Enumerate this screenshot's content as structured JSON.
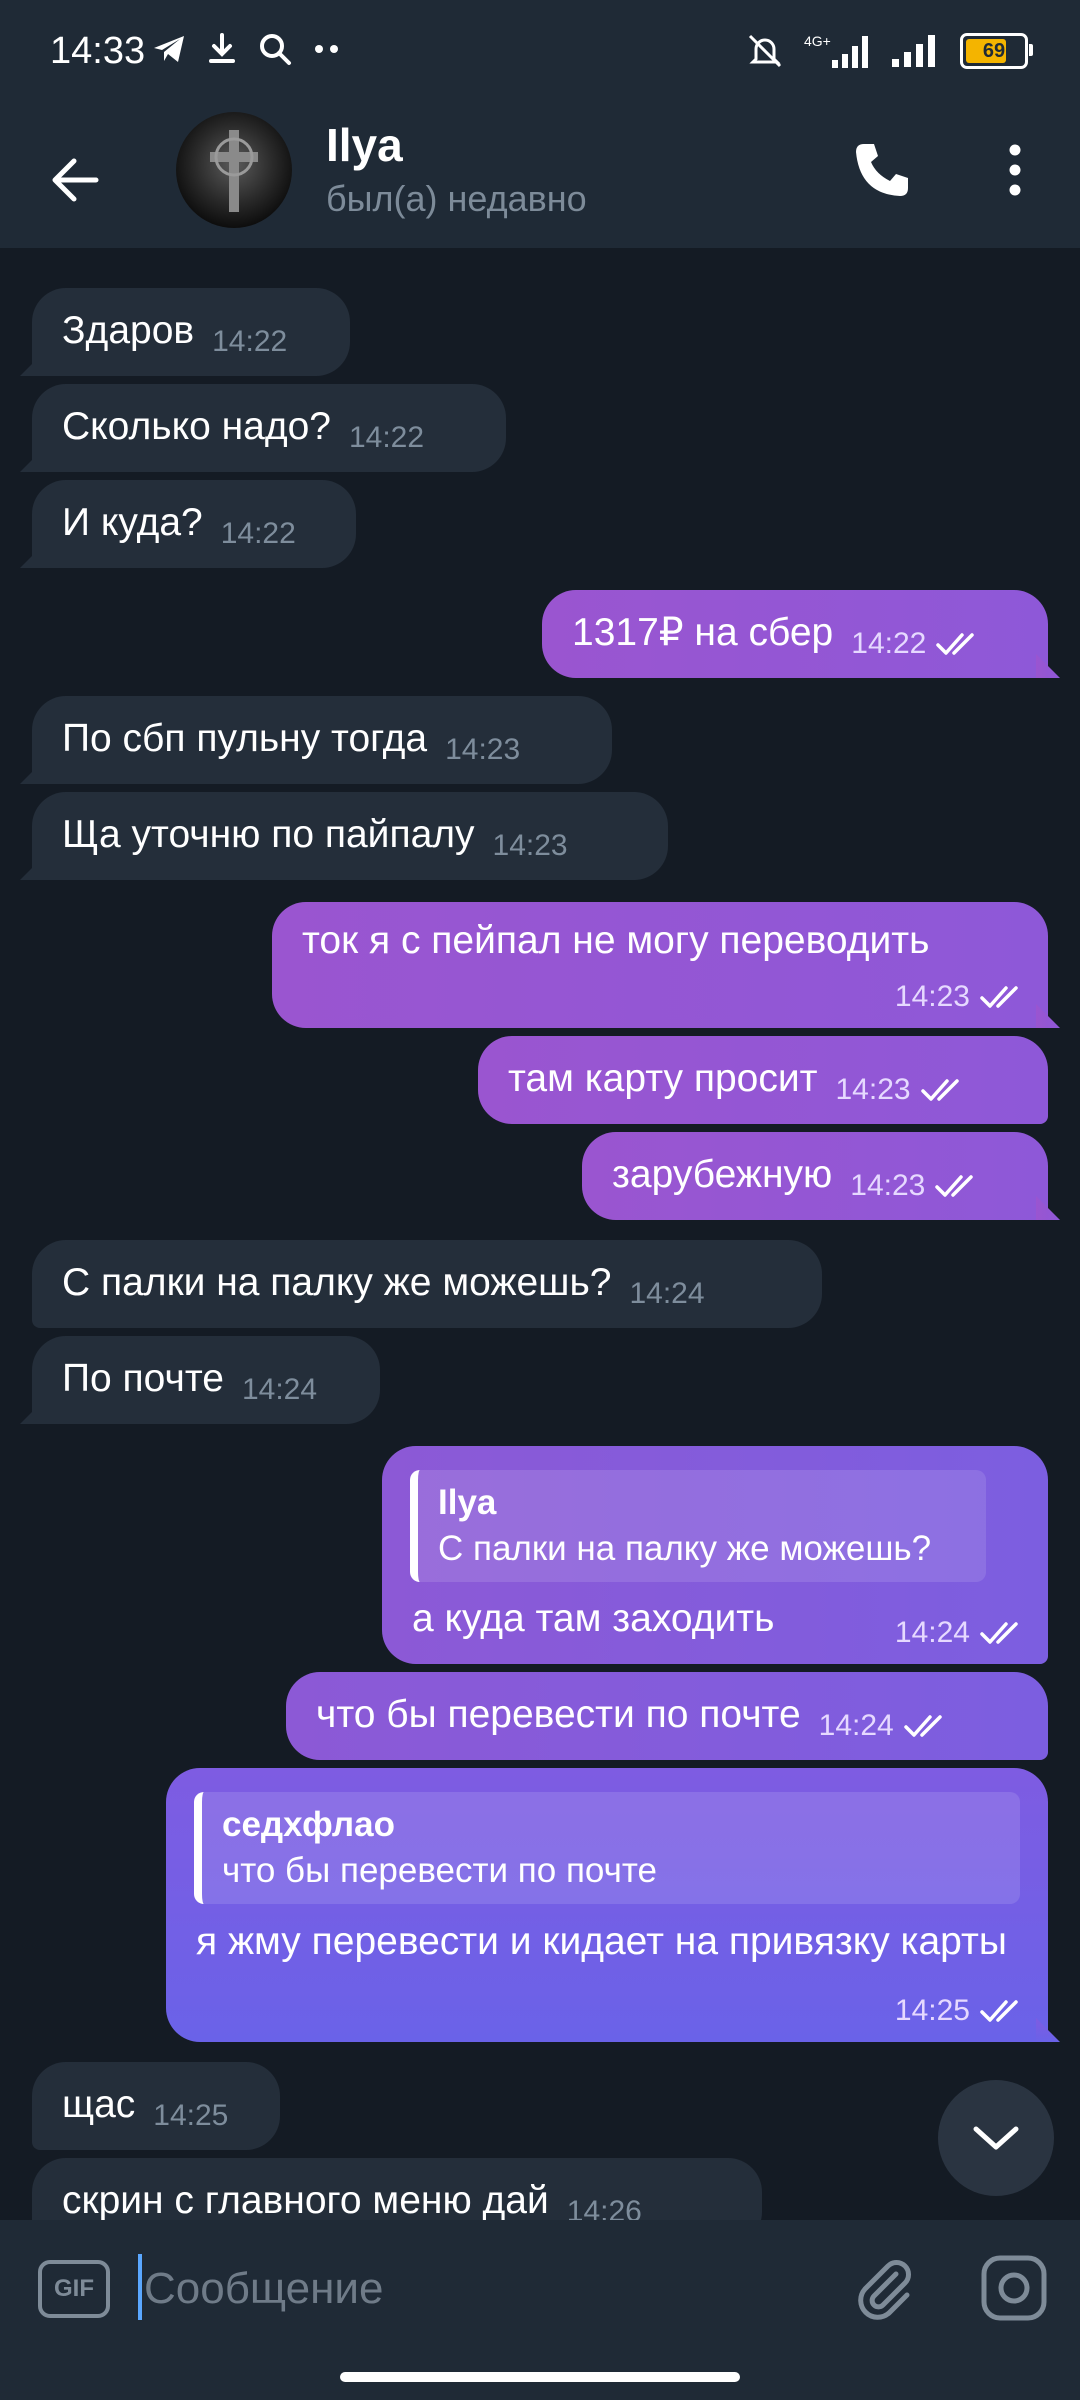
{
  "status_bar": {
    "time": "14:33",
    "network": "4G+",
    "battery": "69"
  },
  "header": {
    "name": "Ilya",
    "status": "был(а) недавно"
  },
  "messages": [
    {
      "dir": "in",
      "text": "Здаров",
      "time": "14:22"
    },
    {
      "dir": "in",
      "text": "Сколько надо?",
      "time": "14:22"
    },
    {
      "dir": "in",
      "text": "И куда?",
      "time": "14:22"
    },
    {
      "dir": "out",
      "text": "1317₽ на сбер",
      "time": "14:22"
    },
    {
      "dir": "in",
      "text": "По сбп пульну тогда",
      "time": "14:23"
    },
    {
      "dir": "in",
      "text": "Ща уточню по пайпалу",
      "time": "14:23"
    },
    {
      "dir": "out",
      "text": "ток я с пейпал не могу переводить",
      "time": "14:23"
    },
    {
      "dir": "out",
      "text": "там карту просит",
      "time": "14:23"
    },
    {
      "dir": "out",
      "text": "зарубежную",
      "time": "14:23"
    },
    {
      "dir": "in",
      "text": "С палки на палку же можешь?",
      "time": "14:24"
    },
    {
      "dir": "in",
      "text": "По почте",
      "time": "14:24"
    },
    {
      "dir": "out",
      "text": "а куда там заходить",
      "time": "14:24",
      "reply_name": "Ilya",
      "reply_text": "С палки на палку же можешь?"
    },
    {
      "dir": "out",
      "text": "что бы перевести по почте",
      "time": "14:24"
    },
    {
      "dir": "out",
      "text": "я жму перевести  и кидает на привязку карты",
      "time": "14:25",
      "reply_name": "седхфлао",
      "reply_text": "что бы перевести по почте"
    },
    {
      "dir": "in",
      "text": "щас",
      "time": "14:25"
    },
    {
      "dir": "in",
      "text": "скрин с главного меню дай",
      "time": "14:26"
    }
  ],
  "input": {
    "placeholder": "Сообщение",
    "gif_label": "GIF"
  },
  "colors": {
    "background": "#141b24",
    "header": "#1f2a36",
    "incoming_bubble": "#242e3a",
    "outgoing_bubble": "#8a55d4",
    "accent": "#5aa7ff"
  }
}
